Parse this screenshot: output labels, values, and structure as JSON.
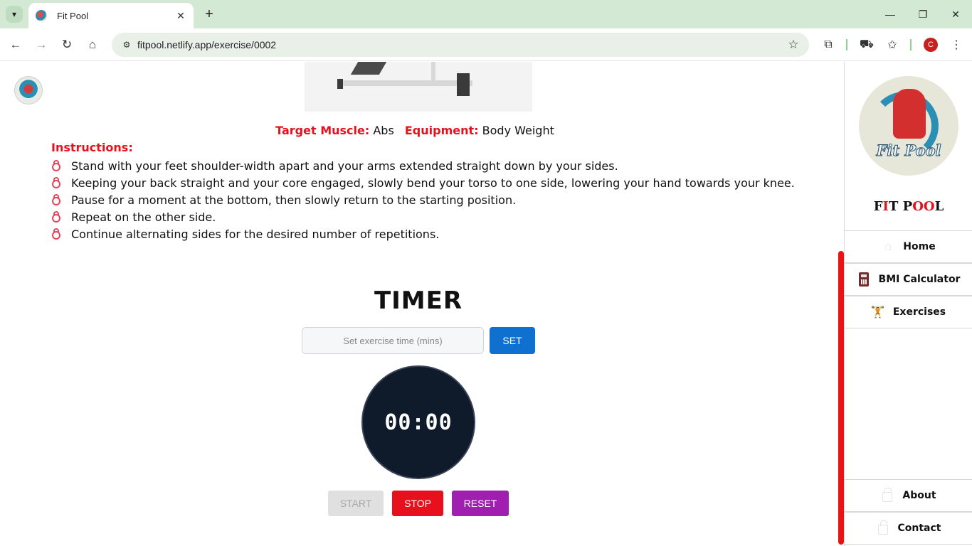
{
  "browser": {
    "tab_title": "Fit Pool",
    "url": "fitpool.netlify.app/exercise/0002",
    "profile_initial": "C"
  },
  "exercise": {
    "target_label": "Target Muscle:",
    "target_value": "Abs",
    "equipment_label": "Equipment:",
    "equipment_value": "Body Weight",
    "instructions_heading": "Instructions:",
    "instructions": [
      "Stand with your feet shoulder-width apart and your arms extended straight down by your sides.",
      "Keeping your back straight and your core engaged, slowly bend your torso to one side, lowering your hand towards your knee.",
      "Pause for a moment at the bottom, then slowly return to the starting position.",
      "Repeat on the other side.",
      "Continue alternating sides for the desired number of repetitions."
    ]
  },
  "timer": {
    "title": "TIMER",
    "input_placeholder": "Set exercise time (mins)",
    "input_value": "",
    "set_label": "SET",
    "display": "00:00",
    "start_label": "START",
    "stop_label": "STOP",
    "reset_label": "RESET"
  },
  "sidebar": {
    "logo_text": "Fit Pool",
    "brand": [
      "F",
      "I",
      "T",
      " ",
      "P",
      "O",
      "O",
      "L"
    ],
    "items": [
      {
        "label": "Home",
        "icon": "home-icon"
      },
      {
        "label": "BMI Calculator",
        "icon": "calculator-icon"
      },
      {
        "label": "Exercises",
        "icon": "dumbbell-icon"
      },
      {
        "label": "About",
        "icon": "lock-icon"
      },
      {
        "label": "Contact",
        "icon": "lock-icon"
      }
    ]
  },
  "colors": {
    "accent_red": "#e8101d",
    "set_blue": "#0f70cf",
    "reset_purple": "#a01fb0",
    "clock_bg": "#0f1a2b",
    "browser_green": "#d3e9d3"
  }
}
